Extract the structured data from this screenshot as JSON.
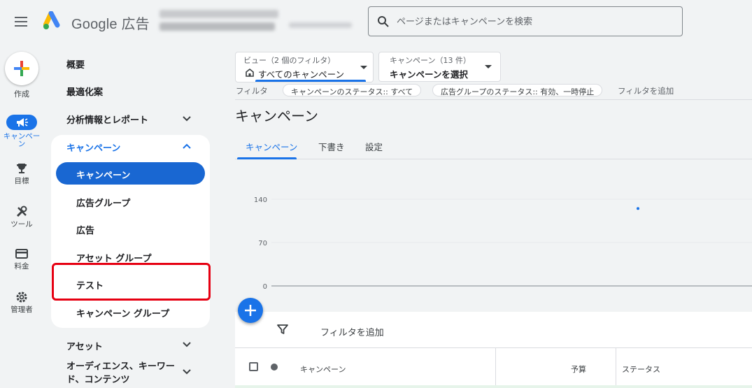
{
  "header": {
    "brand": "Google 広告",
    "search_placeholder": "ページまたはキャンペーンを検索"
  },
  "rail": {
    "create_label": "作成",
    "items": [
      {
        "label": "キャンペーン",
        "icon": "megaphone-icon",
        "active": true
      },
      {
        "label": "目標",
        "icon": "trophy-icon"
      },
      {
        "label": "ツール",
        "icon": "tools-icon"
      },
      {
        "label": "料金",
        "icon": "credit-card-icon"
      },
      {
        "label": "管理者",
        "icon": "gear-icon"
      }
    ]
  },
  "nav": {
    "top_items": [
      "概要",
      "最適化案",
      "分析情報とレポート"
    ],
    "section": {
      "label": "キャンペーン",
      "items": [
        "キャンペーン",
        "広告グループ",
        "広告",
        "アセット グループ",
        "テスト",
        "キャンペーン グループ"
      ]
    },
    "bottom_items": [
      "アセット",
      "オーディエンス、キーワード、コンテンツ"
    ]
  },
  "toolbar": {
    "view_caption": "ビュー（2 個のフィルタ）",
    "view_value": "すべてのキャンペーン",
    "campaign_caption": "キャンペーン（13 件）",
    "campaign_value": "キャンペーンを選択"
  },
  "filters": {
    "label": "フィルタ",
    "chips": [
      "キャンペーンのステータス:: すべて",
      "広告グループのステータス:: 有効、一時停止"
    ],
    "add": "フィルタを追加"
  },
  "page": {
    "title": "キャンペーン",
    "tabs": [
      "キャンペーン",
      "下書き",
      "設定"
    ]
  },
  "chart_data": {
    "type": "scatter",
    "y_ticks": [
      "140",
      "70",
      "0"
    ],
    "ylim": [
      0,
      140
    ],
    "points": [
      {
        "y": 125
      }
    ],
    "grid": true,
    "accent": "#1a73e8"
  },
  "table": {
    "filter_label": "フィルタを追加",
    "headers": [
      "キャンペーン",
      "予算",
      "ステータス"
    ]
  },
  "colors": {
    "accent": "#1a73e8",
    "highlight_box": "#e60012"
  }
}
